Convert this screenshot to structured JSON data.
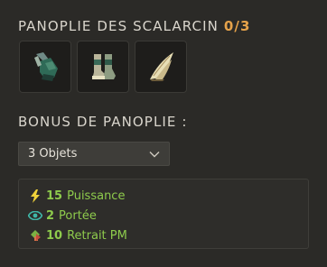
{
  "set": {
    "title": "PANOPLIE DES SCALARCIN",
    "owned_count": "0/3",
    "items": [
      {
        "name": "scalarcin-gauntlet-icon"
      },
      {
        "name": "scalarcin-boots-icon"
      },
      {
        "name": "scalarcin-fin-icon"
      }
    ]
  },
  "bonus": {
    "title": "BONUS DE PANOPLIE :",
    "selected_option": "3 Objets",
    "lines": [
      {
        "icon": "power-icon",
        "value": "15",
        "label": "Puissance",
        "icon_color": "#f0d23a"
      },
      {
        "icon": "range-eye-icon",
        "value": "2",
        "label": "Portée",
        "icon_color": "#3fb7a8"
      },
      {
        "icon": "mp-resist-icon",
        "value": "10",
        "label": "Retrait PM",
        "icon_color": "#7bb043"
      }
    ]
  },
  "colors": {
    "accent_count": "#e5a24a",
    "bonus_text": "#8ecb4c"
  }
}
